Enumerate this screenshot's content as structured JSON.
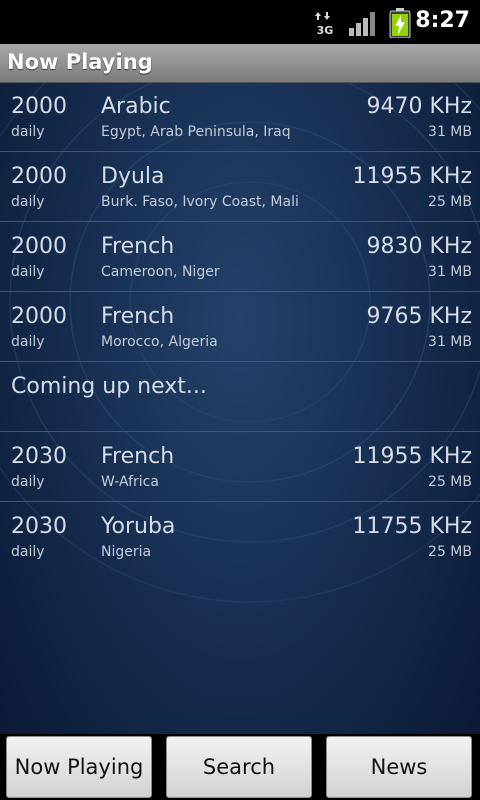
{
  "status_bar": {
    "network_label": "3G",
    "time": "8:27"
  },
  "title_bar": {
    "title": "Now Playing"
  },
  "now_playing": [
    {
      "time": "2000",
      "schedule": "daily",
      "language": "Arabic",
      "region": "Egypt, Arab Peninsula, Iraq",
      "frequency": "9470 KHz",
      "size": "31 MB"
    },
    {
      "time": "2000",
      "schedule": "daily",
      "language": "Dyula",
      "region": "Burk. Faso, Ivory Coast, Mali",
      "frequency": "11955 KHz",
      "size": "25 MB"
    },
    {
      "time": "2000",
      "schedule": "daily",
      "language": "French",
      "region": "Cameroon, Niger",
      "frequency": "9830 KHz",
      "size": "31 MB"
    },
    {
      "time": "2000",
      "schedule": "daily",
      "language": "French",
      "region": "Morocco, Algeria",
      "frequency": "9765 KHz",
      "size": "31 MB"
    }
  ],
  "coming_up": {
    "title": "Coming up next...",
    "items": [
      {
        "time": "2030",
        "schedule": "daily",
        "language": "French",
        "region": "W-Africa",
        "frequency": "11955 KHz",
        "size": "25 MB"
      },
      {
        "time": "2030",
        "schedule": "daily",
        "language": "Yoruba",
        "region": "Nigeria",
        "frequency": "11755 KHz",
        "size": "25 MB"
      }
    ]
  },
  "bottom_nav": {
    "now_playing_label": "Now Playing",
    "search_label": "Search",
    "news_label": "News"
  },
  "colors": {
    "background": "#1a3358",
    "title_bar": "#9a9a9a",
    "text": "#d7dce4",
    "divider": "#3e5678"
  }
}
